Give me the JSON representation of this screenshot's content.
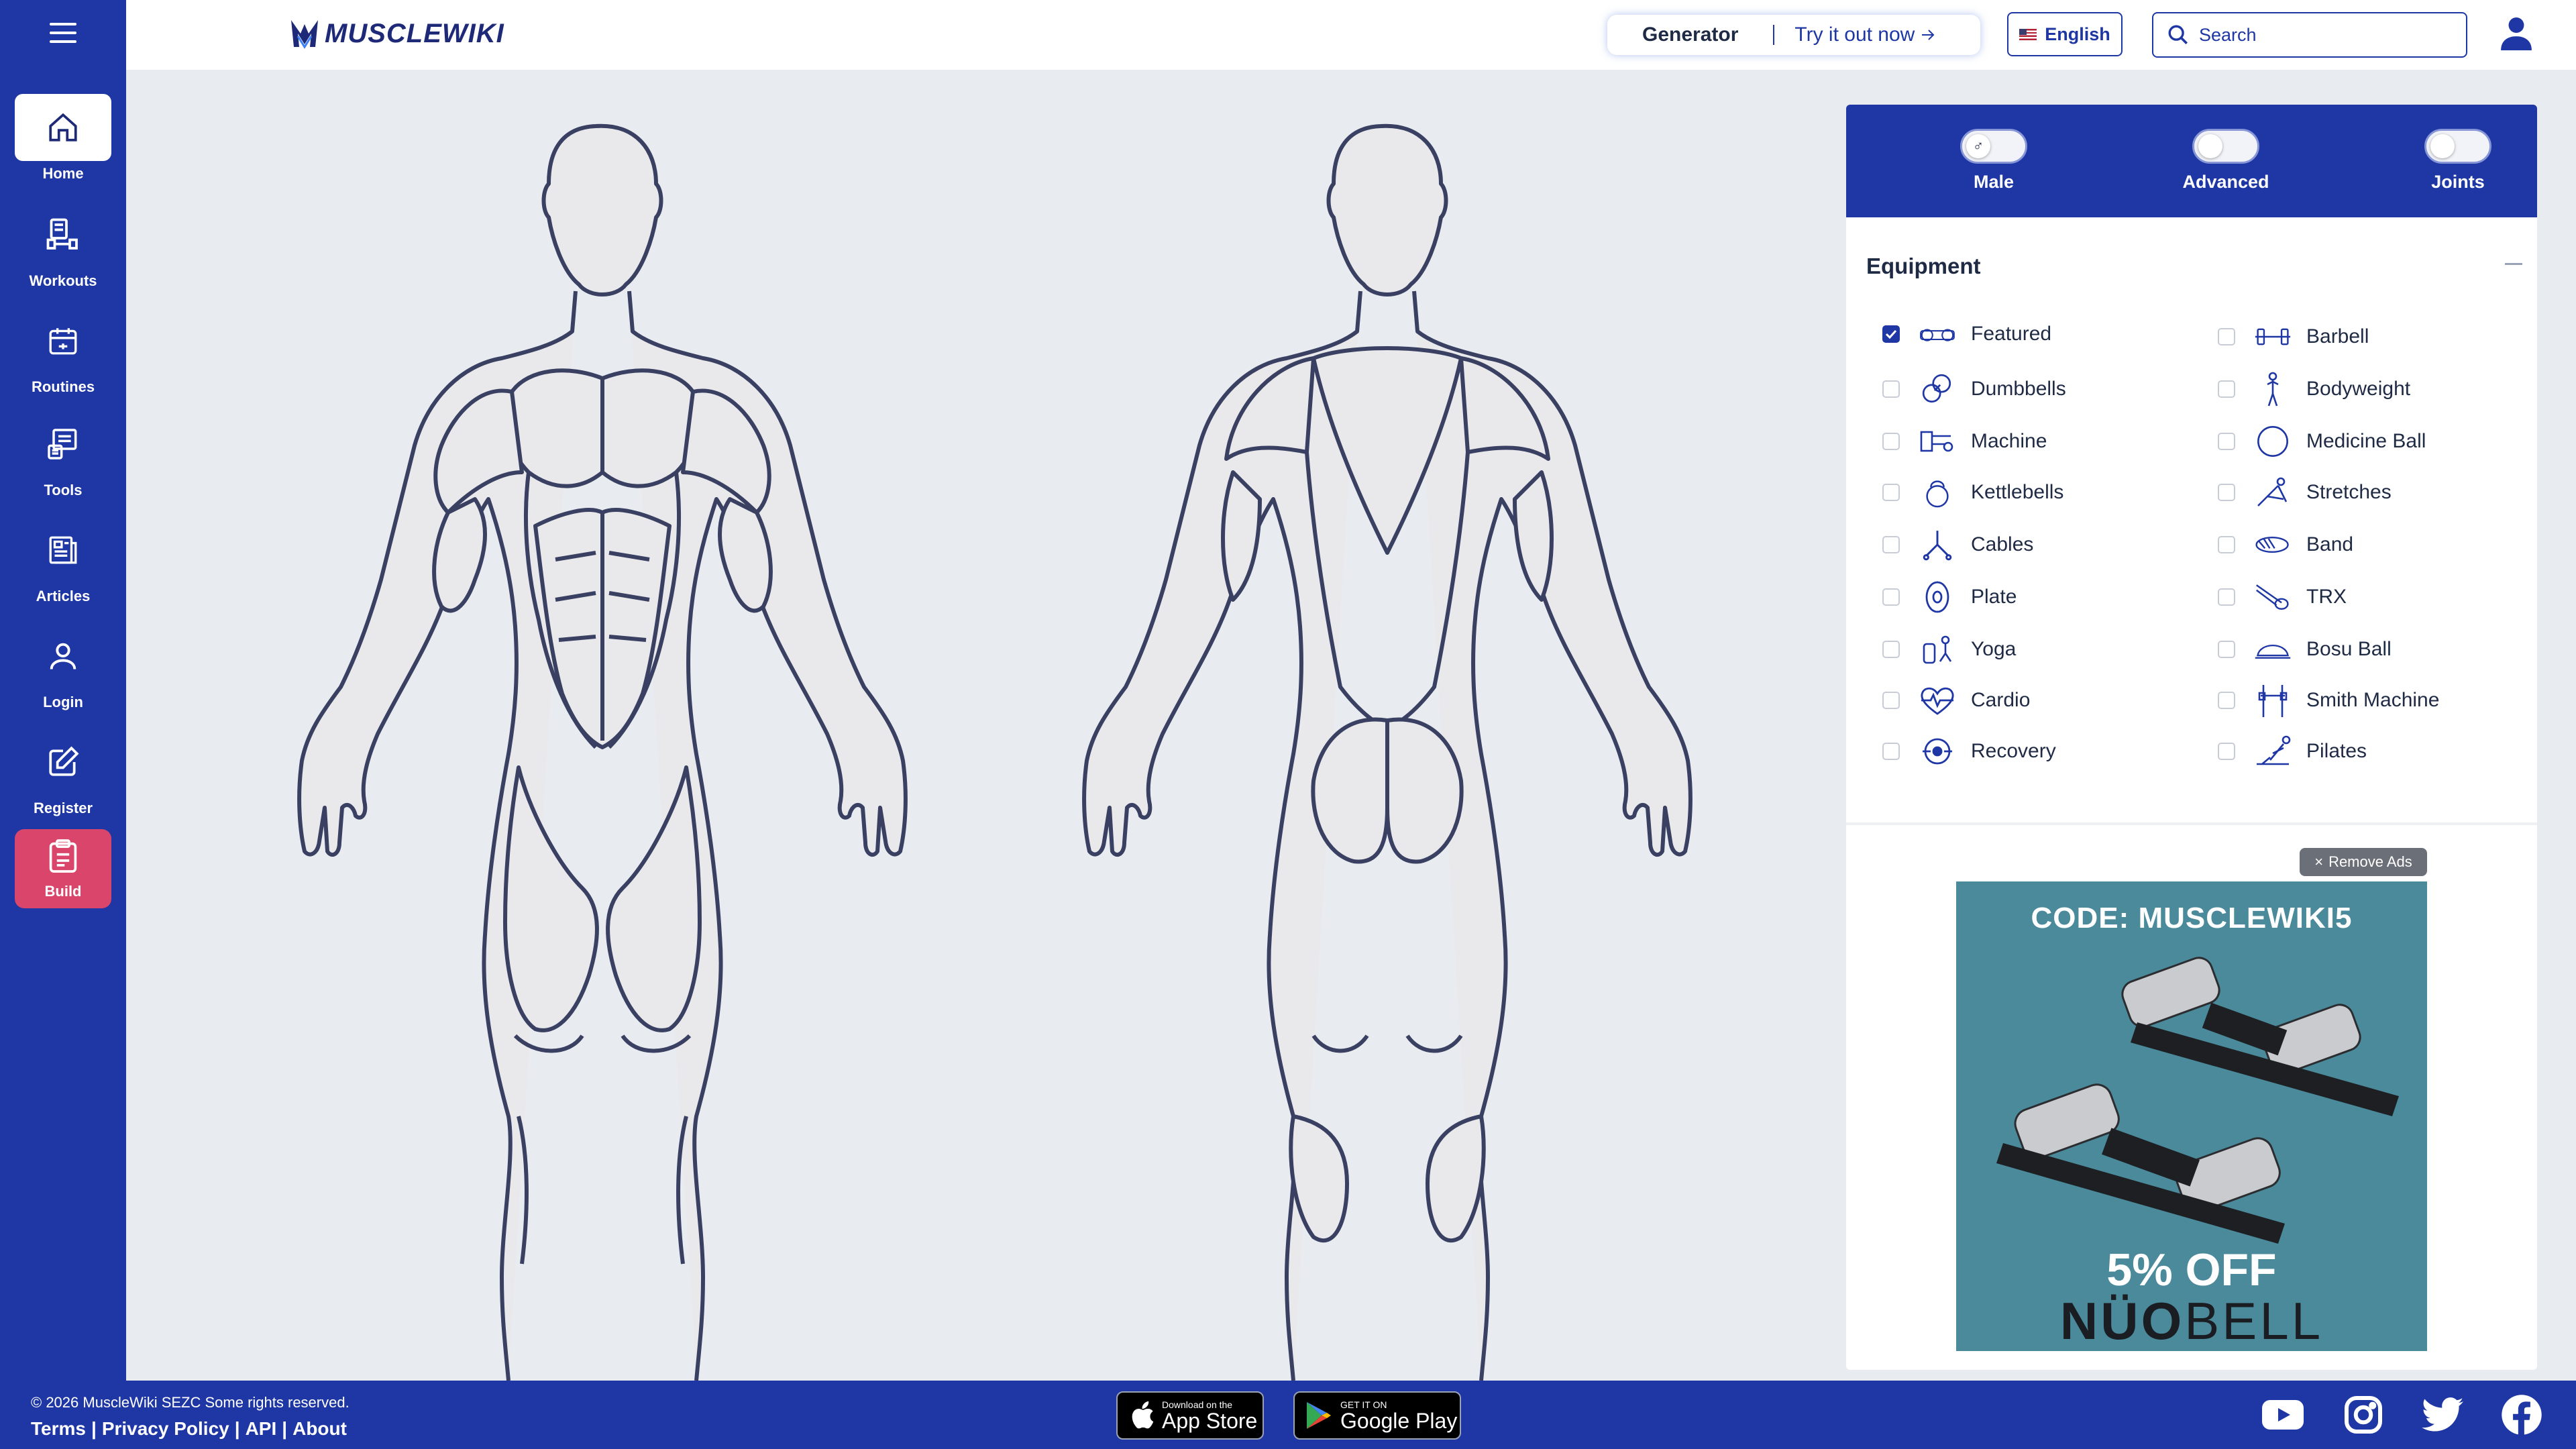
{
  "sidebar": {
    "items": [
      {
        "label": "Home",
        "icon": "home-icon"
      },
      {
        "label": "Workouts",
        "icon": "workouts-icon"
      },
      {
        "label": "Routines",
        "icon": "calendar-icon"
      },
      {
        "label": "Tools",
        "icon": "tools-icon"
      },
      {
        "label": "Articles",
        "icon": "articles-icon"
      },
      {
        "label": "Login",
        "icon": "user-icon"
      },
      {
        "label": "Register",
        "icon": "edit-icon"
      },
      {
        "label": "Build",
        "icon": "clipboard-icon"
      }
    ]
  },
  "header": {
    "logo": "MUSCLEWIKI",
    "generator_title": "Generator",
    "generator_link": "Try it out now",
    "language": "English",
    "search_placeholder": "Search"
  },
  "panel": {
    "toggles": [
      {
        "label": "Male",
        "symbol": "♂"
      },
      {
        "label": "Advanced",
        "symbol": ""
      },
      {
        "label": "Joints",
        "symbol": ""
      }
    ],
    "equipment_title": "Equipment",
    "equipment_left": [
      {
        "label": "Featured",
        "checked": true
      },
      {
        "label": "Dumbbells",
        "checked": false
      },
      {
        "label": "Machine",
        "checked": false
      },
      {
        "label": "Kettlebells",
        "checked": false
      },
      {
        "label": "Cables",
        "checked": false
      },
      {
        "label": "Plate",
        "checked": false
      },
      {
        "label": "Yoga",
        "checked": false
      },
      {
        "label": "Cardio",
        "checked": false
      },
      {
        "label": "Recovery",
        "checked": false
      }
    ],
    "equipment_right": [
      {
        "label": "Barbell",
        "checked": false
      },
      {
        "label": "Bodyweight",
        "checked": false
      },
      {
        "label": "Medicine Ball",
        "checked": false
      },
      {
        "label": "Stretches",
        "checked": false
      },
      {
        "label": "Band",
        "checked": false
      },
      {
        "label": "TRX",
        "checked": false
      },
      {
        "label": "Bosu Ball",
        "checked": false
      },
      {
        "label": "Smith Machine",
        "checked": false
      },
      {
        "label": "Pilates",
        "checked": false
      }
    ],
    "remove_ads": "Remove Ads",
    "ad": {
      "code": "CODE: MUSCLEWIKI5",
      "offer": "5% OFF",
      "brand_a": "NÜO",
      "brand_b": "BELL"
    }
  },
  "footer": {
    "copyright": "© 2026 MuscleWiki SEZC Some rights reserved.",
    "links": [
      "Terms",
      "Privacy Policy",
      "API",
      "About"
    ],
    "app_store_small": "Download on the",
    "app_store_big": "App Store",
    "play_small": "GET IT ON",
    "play_big": "Google Play"
  },
  "colors": {
    "brand": "#1e37a5",
    "build_accent": "#d9456b",
    "background": "#e8ecf0"
  }
}
